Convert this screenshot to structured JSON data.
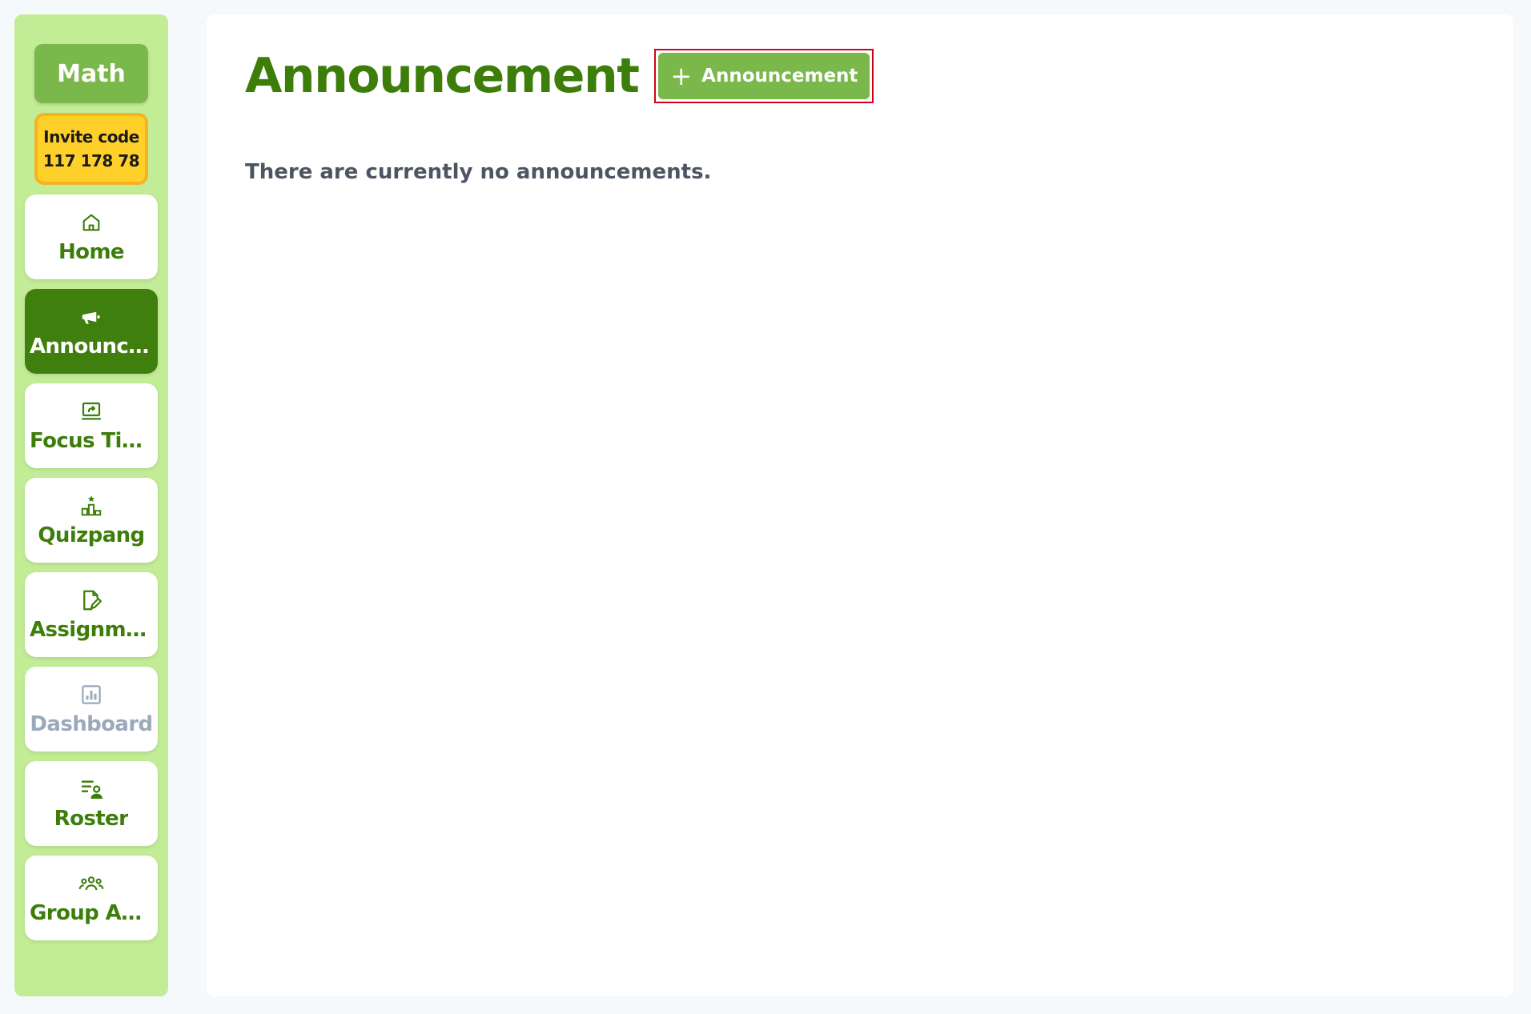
{
  "sidebar": {
    "class_name": "Math",
    "invite": {
      "label": "Invite code",
      "code": "117 178 78"
    },
    "items": [
      {
        "label": "Home",
        "icon": "home-icon",
        "state": "normal"
      },
      {
        "label": "Announcements",
        "icon": "megaphone-icon",
        "state": "active"
      },
      {
        "label": "Focus Time",
        "icon": "screen-share-icon",
        "state": "normal"
      },
      {
        "label": "Quizpang",
        "icon": "podium-star-icon",
        "state": "normal"
      },
      {
        "label": "Assignments",
        "icon": "edit-document-icon",
        "state": "normal"
      },
      {
        "label": "Dashboard",
        "icon": "bar-chart-icon",
        "state": "disabled"
      },
      {
        "label": "Roster",
        "icon": "roster-list-icon",
        "state": "normal"
      },
      {
        "label": "Group Activity",
        "icon": "group-people-icon",
        "state": "normal"
      }
    ]
  },
  "main": {
    "title": "Announcement",
    "add_button_label": "Announcement",
    "empty_message": "There are currently no announcements."
  },
  "colors": {
    "brand_green": "#3d7e0b",
    "button_green": "#7bb84b",
    "sidebar_bg": "#c3ec97",
    "invite_yellow": "#ffd02a",
    "highlight_red": "#d0021b"
  }
}
